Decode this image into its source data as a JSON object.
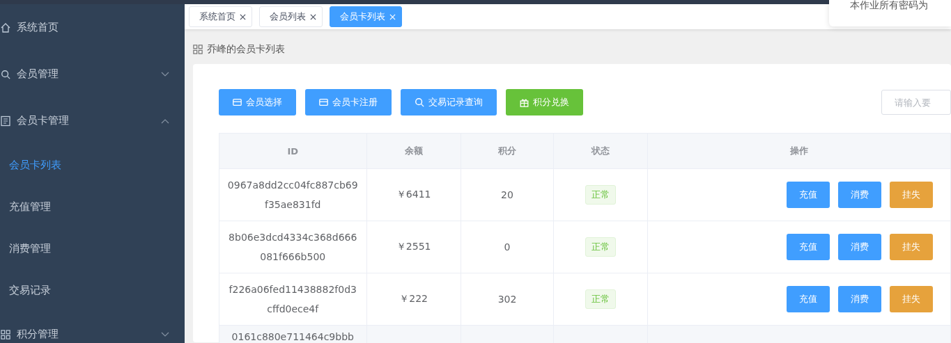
{
  "notice": {
    "text": "本作业所有密码为"
  },
  "sidebar": {
    "items": [
      {
        "label": "系统首页",
        "selected": false
      },
      {
        "label": "会员管理",
        "expanded": false,
        "selected": false
      },
      {
        "label": "会员卡管理",
        "expanded": true,
        "selected": false,
        "children": [
          {
            "label": "会员卡列表",
            "selected": true
          },
          {
            "label": "充值管理",
            "selected": false
          },
          {
            "label": "消费管理",
            "selected": false
          },
          {
            "label": "交易记录",
            "selected": false
          }
        ]
      },
      {
        "label": "积分管理",
        "expanded": false,
        "selected": false
      }
    ]
  },
  "tabs": [
    {
      "label": "系统首页",
      "selected": false
    },
    {
      "label": "会员列表",
      "selected": false
    },
    {
      "label": "会员卡列表",
      "selected": true
    }
  ],
  "page_title": "乔峰的会员卡列表",
  "toolbar": {
    "buttons": [
      {
        "label": "会员选择",
        "kind": "primary"
      },
      {
        "label": "会员卡注册",
        "kind": "primary"
      },
      {
        "label": "交易记录查询",
        "kind": "primary"
      },
      {
        "label": "积分兑换",
        "kind": "success"
      }
    ],
    "search": {
      "placeholder": "请输入要"
    }
  },
  "table": {
    "columns": [
      "ID",
      "余额",
      "积分",
      "状态",
      "操作"
    ],
    "rows": [
      {
        "id": "0967a8dd2cc04fc887cb69f35ae831fd",
        "balance": "￥6411",
        "points": "20",
        "status": "正常",
        "actions": [
          {
            "label": "充值",
            "kind": "primary"
          },
          {
            "label": "消费",
            "kind": "primary"
          },
          {
            "label": "挂失",
            "kind": "warning"
          }
        ]
      },
      {
        "id": "8b06e3dcd4334c368d666081f666b500",
        "balance": "￥2551",
        "points": "0",
        "status": "正常",
        "actions": [
          {
            "label": "充值",
            "kind": "primary"
          },
          {
            "label": "消费",
            "kind": "primary"
          },
          {
            "label": "挂失",
            "kind": "warning"
          }
        ]
      },
      {
        "id": "f226a06fed11438882f0d3cffd0ece4f",
        "balance": "￥222",
        "points": "302",
        "status": "正常",
        "actions": [
          {
            "label": "充值",
            "kind": "primary"
          },
          {
            "label": "消费",
            "kind": "primary"
          },
          {
            "label": "挂失",
            "kind": "warning"
          }
        ]
      },
      {
        "id": "0161c880e711464c9bbb"
      }
    ]
  }
}
